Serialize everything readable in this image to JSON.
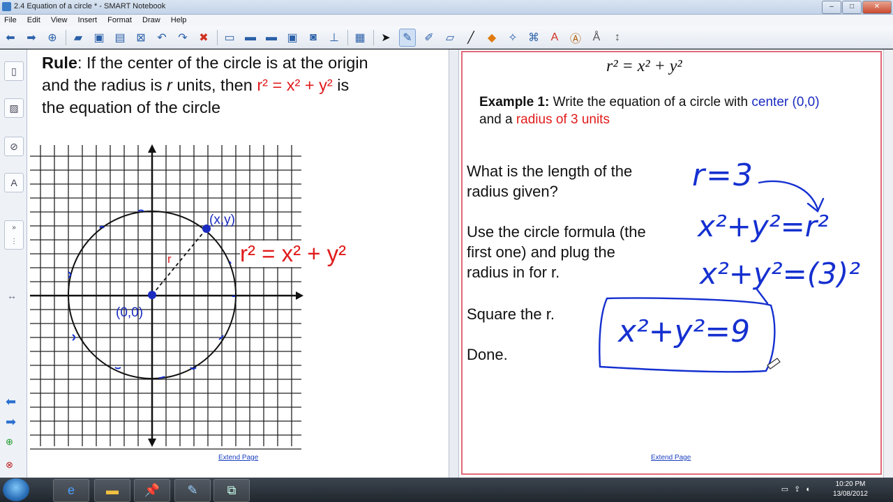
{
  "window": {
    "title": "2.4 Equation of a circle * - SMART Notebook",
    "min": "–",
    "max": "□",
    "close": "✕"
  },
  "menu": [
    "File",
    "Edit",
    "View",
    "Insert",
    "Format",
    "Draw",
    "Help"
  ],
  "toolbar_icons": [
    "back-arrow-icon",
    "forward-arrow-icon",
    "add-page-icon",
    "open-folder-icon",
    "save-icon",
    "paste-icon",
    "delete-page-icon",
    "undo-icon",
    "redo-icon",
    "delete-icon",
    "screen-shade-icon",
    "display-icon",
    "table-icon",
    "select-icon",
    "pen-icon",
    "creative-pen-icon",
    "eraser-icon",
    "line-icon",
    "shapes-icon",
    "magic-pen-icon",
    "fill-icon",
    "text-icon",
    "properties-icon",
    "toolbar-move-icon"
  ],
  "left_page": {
    "rule_label": "Rule",
    "rule_text_1": ": If the center of the circle is at the ",
    "rule_origin": "origin",
    "rule_text_2": "and the radius is ",
    "rule_r": "r",
    "rule_text_3": " units, then ",
    "rule_eq": "r² = x² + y²",
    "rule_text_4": " is",
    "rule_text_5": "the equation of the circle",
    "graph_point_label": "(x,y)",
    "graph_origin_label": "(0,0)",
    "graph_radius_label": "r",
    "graph_equation": "r² = x² + y²",
    "extend_page": "Extend Page"
  },
  "right_page": {
    "formula": "r² = x² + y²",
    "example_label": "Example 1:",
    "example_text_1": " Write the equation of a circle with ",
    "example_center": "center (0,0)",
    "example_text_2": "and a ",
    "example_radius": "radius of 3 units",
    "step1_line1": "What is the length of the",
    "step1_line2": "radius given?",
    "step2_line1": "Use the circle formula (the",
    "step2_line2": "first one) and plug the",
    "step2_line3": "radius in for r.",
    "step3": "Square the r.",
    "step4": "Done.",
    "hand_r": "r=3",
    "hand_formula": "x²+y²=r²",
    "hand_sub": "x²+y²=(3)²",
    "hand_answer": "x²+y²=9",
    "extend_page": "Extend Page"
  },
  "taskbar": {
    "time": "10:20 PM",
    "date": "13/08/2012"
  },
  "colors": {
    "accent_red": "#e01b1b",
    "accent_blue": "#1a2bbf",
    "ink_blue": "#1530d0"
  }
}
